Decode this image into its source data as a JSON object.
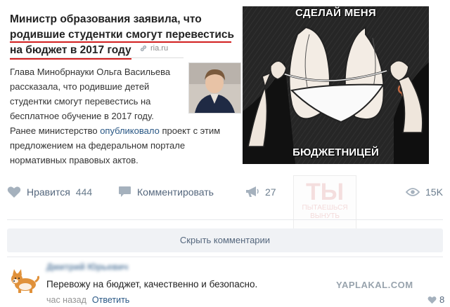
{
  "post": {
    "headline_lines": [
      "Министр образования заявила, что",
      "родившие студентки смогут перевестись",
      "на бюджет в 2017 году"
    ],
    "source": "ria.ru",
    "lead": "Глава Минобрнауки Ольга Васильева рассказала, что родившие детей студентки смогут перевестись на бесплатное обучение в 2017 году.",
    "body_before_link": "Ранее министерство ",
    "body_link": "опубликовало",
    "body_after_link": " проект с этим предложением на федеральном портале нормативных правовых актов.",
    "meme_top": "СДЕЛАЙ МЕНЯ",
    "meme_bottom": "БЮДЖЕТНИЦЕЙ"
  },
  "actions": {
    "like_label": "Нравится",
    "like_count": "444",
    "comment_label": "Комментировать",
    "share_count": "27",
    "views_count": "15K"
  },
  "watermark": {
    "big": "ТЫ",
    "line1": "ПЫТАЕШЬСЯ",
    "line2": "ВЫНУТЬ"
  },
  "hide_comments_label": "Скрыть комментарии",
  "comment": {
    "author": "Дмитрий Юрьевич",
    "text": "Перевожу на бюджет, качественно и безопасно.",
    "time": "час назад",
    "reply_label": "Ответить",
    "likes": "8"
  },
  "site_watermark": "YAPLAKAL.COM"
}
